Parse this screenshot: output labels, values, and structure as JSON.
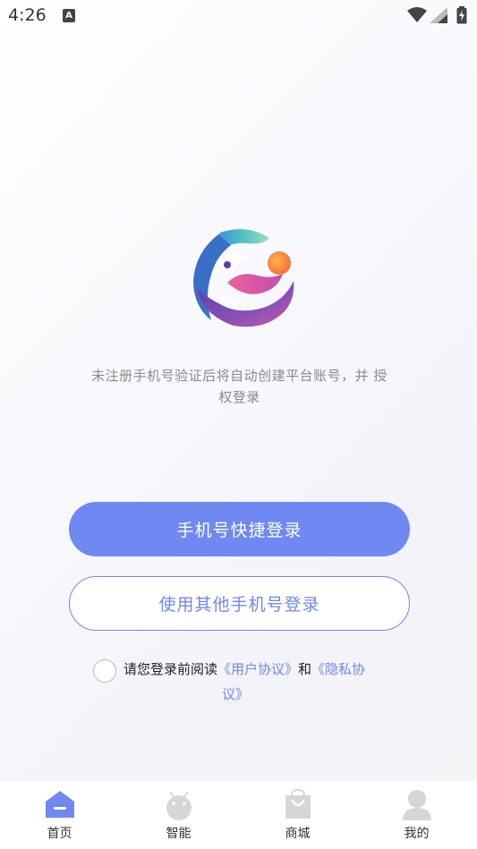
{
  "status_bar": {
    "time": "4:26",
    "notification_glyph": "A",
    "icons": [
      "wifi-icon",
      "signal-icon",
      "battery-icon"
    ]
  },
  "logo": {
    "icon": "app-logo"
  },
  "notice": {
    "line1": "未注册手机号验证后将自动创建平台账号，并 授",
    "line2": "权登录"
  },
  "buttons": {
    "quick_login": "手机号快捷登录",
    "other_phone_login": "使用其他手机号登录"
  },
  "agreement": {
    "prefix": "请您登录前阅读",
    "user_agreement_part": "《用户协议》",
    "connector": "和",
    "privacy_part1": "《隐私协",
    "privacy_part2": "议》"
  },
  "tabbar": {
    "items": [
      {
        "label": "首页",
        "icon": "home-icon",
        "active": true
      },
      {
        "label": "智能",
        "icon": "android-icon",
        "active": false
      },
      {
        "label": "商城",
        "icon": "shopping-bag-icon",
        "active": false
      },
      {
        "label": "我的",
        "icon": "user-icon",
        "active": false
      }
    ]
  },
  "colors": {
    "accent": "#6f88f2",
    "notice_text": "#8a8a8a",
    "tab_inactive_icon": "#d6d6d6"
  }
}
